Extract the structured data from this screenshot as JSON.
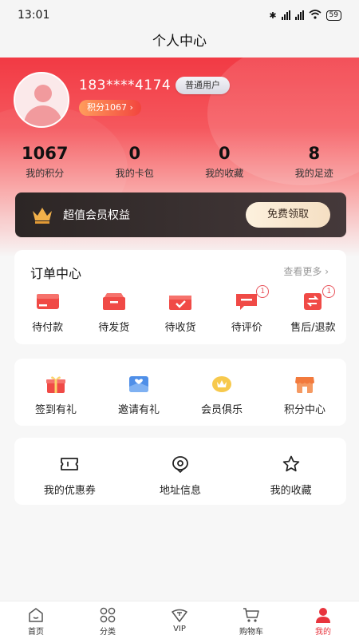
{
  "status_bar": {
    "time": "13:01",
    "battery": "59"
  },
  "title": "个人中心",
  "profile": {
    "phone": "183****4174",
    "level": "普通用户",
    "points_pill": "积分1067 ›"
  },
  "stats": [
    {
      "value": "1067",
      "label": "我的积分"
    },
    {
      "value": "0",
      "label": "我的卡包"
    },
    {
      "value": "0",
      "label": "我的收藏"
    },
    {
      "value": "8",
      "label": "我的足迹"
    }
  ],
  "vip": {
    "text": "超值会员权益",
    "button": "免费领取"
  },
  "orders": {
    "title": "订单中心",
    "more": "查看更多 ›",
    "items": [
      {
        "label": "待付款",
        "icon": "wallet-icon",
        "badge": ""
      },
      {
        "label": "待发货",
        "icon": "box-icon",
        "badge": ""
      },
      {
        "label": "待收货",
        "icon": "package-check-icon",
        "badge": ""
      },
      {
        "label": "待评价",
        "icon": "comment-icon",
        "badge": "1"
      },
      {
        "label": "售后/退款",
        "icon": "refund-icon",
        "badge": "1"
      }
    ]
  },
  "services": [
    {
      "label": "签到有礼",
      "icon": "gift-icon"
    },
    {
      "label": "邀请有礼",
      "icon": "invite-envelope-icon"
    },
    {
      "label": "会员俱乐",
      "icon": "crown-badge-icon"
    },
    {
      "label": "积分中心",
      "icon": "store-icon"
    }
  ],
  "tools": [
    {
      "label": "我的优惠券",
      "icon": "ticket-icon"
    },
    {
      "label": "地址信息",
      "icon": "location-icon"
    },
    {
      "label": "我的收藏",
      "icon": "star-icon"
    }
  ],
  "tabbar": [
    {
      "label": "首页",
      "icon": "home-icon"
    },
    {
      "label": "分类",
      "icon": "grid-icon"
    },
    {
      "label": "VIP",
      "icon": "vip-icon"
    },
    {
      "label": "购物车",
      "icon": "cart-icon"
    },
    {
      "label": "我的",
      "icon": "user-icon",
      "active": true
    }
  ],
  "colors": {
    "brand_red": "#f23a44",
    "vip_dark": "#2c2625",
    "badge_red": "#e8525a"
  }
}
